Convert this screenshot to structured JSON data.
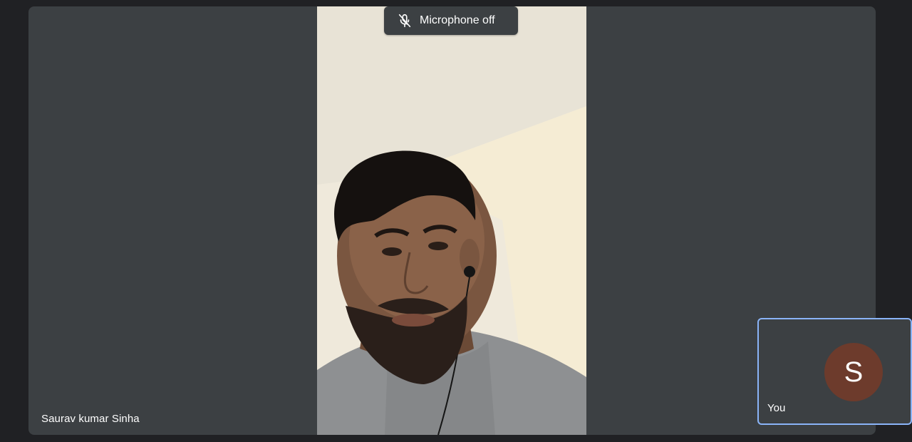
{
  "meeting": {
    "main_participant": {
      "name": "Saurav kumar Sinha"
    },
    "mic_status": {
      "label": "Microphone off",
      "icon": "microphone-off-icon"
    },
    "self_view": {
      "avatar_letter": "S",
      "label": "You",
      "avatar_color": "#6d3b2c",
      "active_border_color": "#8ab4f8"
    }
  },
  "colors": {
    "background": "#202124",
    "tile": "#3c4043"
  }
}
